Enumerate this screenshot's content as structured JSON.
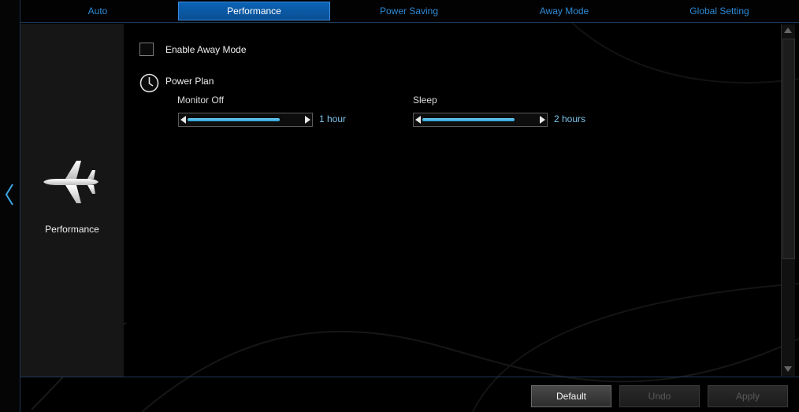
{
  "tabs": [
    {
      "label": "Auto"
    },
    {
      "label": "Performance"
    },
    {
      "label": "Power Saving"
    },
    {
      "label": "Away Mode"
    },
    {
      "label": "Global Setting"
    }
  ],
  "active_tab": "Performance",
  "side_panel": {
    "icon": "airplane-icon",
    "label": "Performance"
  },
  "content": {
    "enable_away_mode": {
      "label": "Enable Away Mode",
      "checked": false
    },
    "power_plan": {
      "title": "Power Plan",
      "icon": "clock-icon",
      "monitor_off": {
        "label": "Monitor Off",
        "value": "1 hour",
        "level": 0.8
      },
      "sleep": {
        "label": "Sleep",
        "value": "2 hours",
        "level": 0.8
      }
    }
  },
  "footer": {
    "default_label": "Default",
    "undo_label": "Undo",
    "apply_label": "Apply"
  },
  "colors": {
    "accent": "#0b63b5",
    "tab_text": "#2f8ad6",
    "slider_fill": "#2aa0d8",
    "value_text": "#7ec4ec"
  }
}
